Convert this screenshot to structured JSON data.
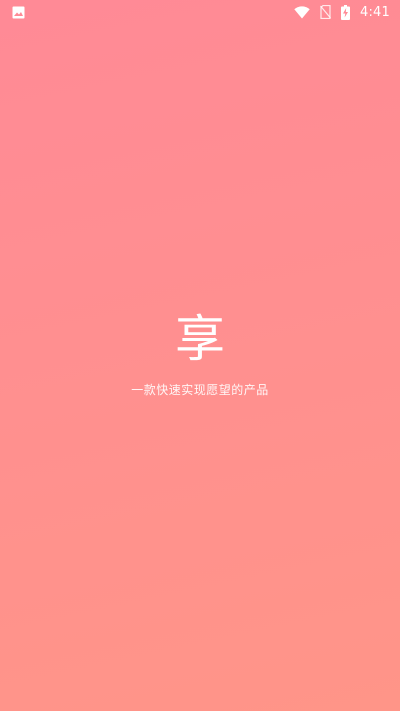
{
  "status_bar": {
    "time": "4:41",
    "left_icon": "image-icon",
    "icons": [
      "wifi-icon",
      "no-sim-icon",
      "battery-charging-icon"
    ]
  },
  "splash": {
    "logo_text": "享",
    "slogan": "一款快速实现愿望的产品"
  },
  "colors": {
    "gradient_top": "#ff8a96",
    "gradient_bottom": "#ff9588",
    "text": "#ffffff"
  }
}
